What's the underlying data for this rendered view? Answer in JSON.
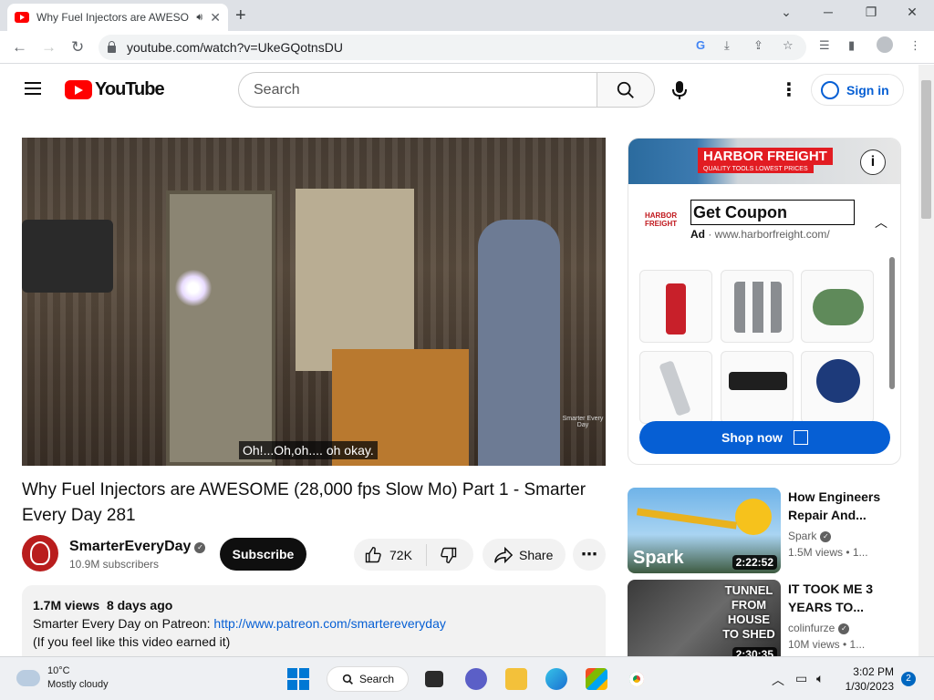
{
  "browser": {
    "tab_title": "Why Fuel Injectors are AWESOME",
    "tab_close": "✕",
    "new_tab": "+",
    "url": "youtube.com/watch?v=UkeGQotnsDU",
    "min": "⌄",
    "minimize": "─",
    "restore": "❐",
    "close": "✕"
  },
  "header": {
    "logo_text": "YouTube",
    "search_placeholder": "Search",
    "signin_label": "Sign in"
  },
  "player": {
    "caption": "Oh!...Oh,oh.... oh okay.",
    "watermark": "Smarter Every Day"
  },
  "ad": {
    "banner_brand": "HARBOR FREIGHT",
    "banner_sub": "QUALITY TOOLS  LOWEST PRICES",
    "logo_line1": "HARBOR",
    "logo_line2": "FREIGHT",
    "headline": "Get Coupon",
    "label": "Ad",
    "domain": "· www.harborfreight.com/",
    "cta": "Shop now"
  },
  "video": {
    "title": "Why Fuel Injectors are AWESOME (28,000 fps Slow Mo) Part 1 - Smarter Every Day 281",
    "channel": "SmarterEveryDay",
    "subscribers": "10.9M subscribers",
    "subscribe_label": "Subscribe",
    "likes": "72K",
    "share_label": "Share",
    "views": "1.7M views",
    "age": "8 days ago",
    "desc_line1_prefix": "Smarter Every Day on Patreon: ",
    "desc_link": "http://www.patreon.com/smartereveryday",
    "desc_line2": "(If you feel like this video earned it)"
  },
  "recommendations": [
    {
      "title": "How Engineers Repair And...",
      "channel": "Spark",
      "meta": "1.5M views  •  1...",
      "duration": "2:22:52",
      "thumb_label": "Spark"
    },
    {
      "title": "IT TOOK ME 3 YEARS TO...",
      "channel": "colinfurze",
      "meta": "10M views  •  1...",
      "duration": "2:30:35",
      "thumb_label": "TUNNEL FROM HOUSE TO SHED"
    }
  ],
  "taskbar": {
    "temp": "10°C",
    "condition": "Mostly cloudy",
    "search_label": "Search",
    "time": "3:02 PM",
    "date": "1/30/2023",
    "notifications": "2"
  }
}
